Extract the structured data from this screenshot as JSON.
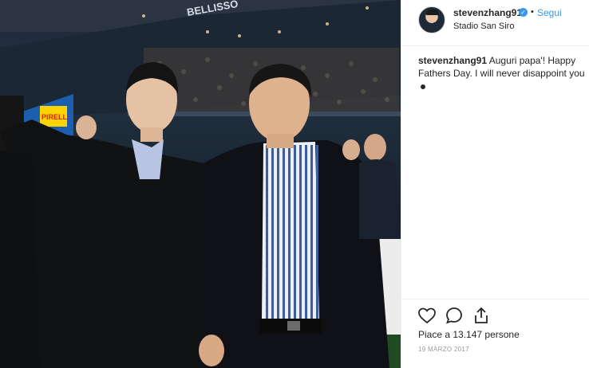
{
  "post": {
    "username": "stevenzhang91",
    "verified_icon": "verified-check-icon",
    "separator": "•",
    "follow_label": "Segui",
    "location": "Stadio San Siro",
    "caption": {
      "username": "stevenzhang91",
      "text": "Auguri papa'! Happy Fathers Day. I will never disappoint you"
    },
    "likes_text": "Piace a 13.147 persone",
    "date": "19 MARZO 2017"
  },
  "photo": {
    "scene": "stadium-night-photo",
    "banner_text": "PIRELLI",
    "stand_text": "BELLISSO"
  },
  "icons": {
    "like": "heart-outline-icon",
    "comment": "comment-bubble-icon",
    "share": "share-upload-icon"
  },
  "colors": {
    "link": "#3897f0",
    "text": "#262626",
    "muted": "#999999",
    "divider": "#efefef"
  }
}
